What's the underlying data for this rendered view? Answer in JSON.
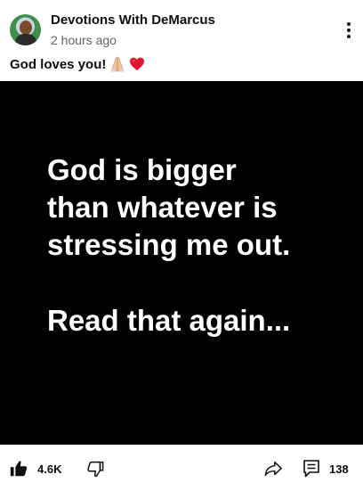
{
  "post": {
    "channel_name": "Devotions With DeMarcus",
    "timestamp": "2 hours ago",
    "caption": "God loves you!",
    "caption_emojis": [
      "folded-hands-icon",
      "red-heart-icon"
    ],
    "image_text_main": "God is bigger\nthan whatever is\nstressing me out.",
    "image_text_secondary": "Read that again...",
    "image_background": "#000000",
    "image_text_color": "#ffffff"
  },
  "actions": {
    "like_count": "4.6K",
    "comment_count": "138"
  },
  "icons": {
    "menu": "more-vertical-icon",
    "like": "thumbs-up-icon",
    "dislike": "thumbs-down-icon",
    "share": "share-icon",
    "comment": "comment-icon"
  }
}
